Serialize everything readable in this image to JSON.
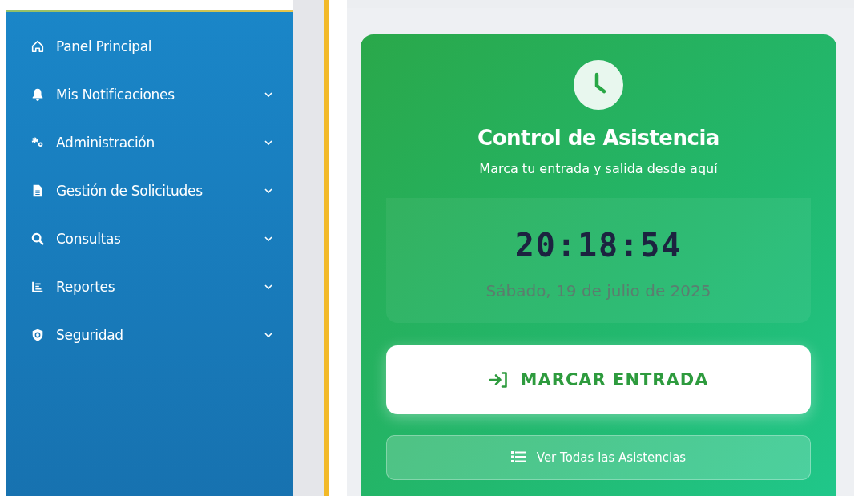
{
  "sidebar": {
    "items": [
      {
        "label": "Panel Principal",
        "kind": "link"
      },
      {
        "label": "Mis Notificaciones",
        "kind": "menu",
        "expanded": false
      },
      {
        "label": "Administración",
        "kind": "menu",
        "expanded": false
      },
      {
        "label": "Gestión de Solicitudes",
        "kind": "menu",
        "expanded": false
      },
      {
        "label": "Consultas",
        "kind": "menu",
        "expanded": false
      },
      {
        "label": "Reportes",
        "kind": "menu",
        "expanded": false
      },
      {
        "label": "Seguridad",
        "kind": "menu",
        "expanded": false
      }
    ]
  },
  "attendance_card": {
    "title": "Control de Asistencia",
    "subtitle": "Marca tu entrada y salida desde aquí",
    "time": "20:18:54",
    "date": "Sábado, 19 de julio de 2025",
    "buttons": [
      {
        "label": "MARCAR ENTRADA",
        "kind": "primary"
      },
      {
        "label": "Ver Todas las Asistencias",
        "kind": "secondary"
      }
    ]
  }
}
